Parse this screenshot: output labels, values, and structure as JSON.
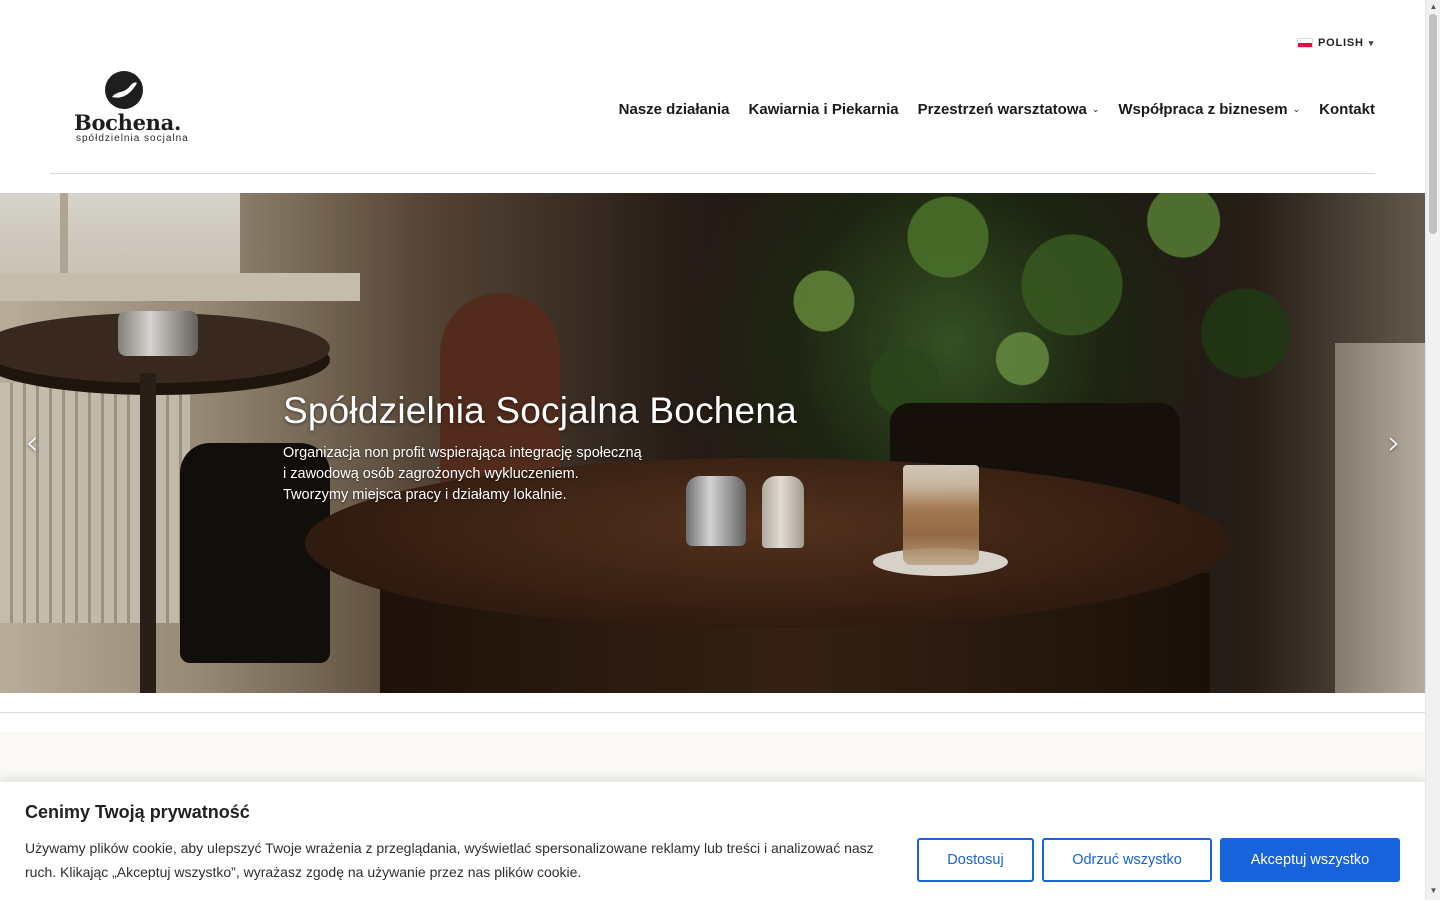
{
  "language": {
    "label": "POLISH",
    "caret": "▾"
  },
  "logo": {
    "name": "Bochena.",
    "tagline": "spółdzielnia socjalna"
  },
  "nav": {
    "items": [
      {
        "label": "Nasze działania",
        "dropdown": false
      },
      {
        "label": "Kawiarnia i Piekarnia",
        "dropdown": false
      },
      {
        "label": "Przestrzeń warsztatowa",
        "dropdown": true
      },
      {
        "label": "Współpraca z biznesem",
        "dropdown": true
      },
      {
        "label": "Kontakt",
        "dropdown": false
      }
    ],
    "chevron": "⌄"
  },
  "hero": {
    "title": "Spółdzielnia Socjalna Bochena",
    "lines": [
      "Organizacja non profit wspierająca integrację społeczną",
      "i zawodową osób zagrożonych wykluczeniem.",
      "Tworzymy miejsca pracy i działamy lokalnie."
    ],
    "prev_arrow": "‹",
    "next_arrow": "›"
  },
  "cookie": {
    "title": "Cenimy Twoją prywatność",
    "text": "Używamy plików cookie, aby ulepszyć Twoje wrażenia z przeglądania, wyświetlać spersonalizowane reklamy lub treści i analizować nasz ruch. Klikając „Akceptuj wszystko”, wyrażasz zgodę na używanie przez nas plików cookie.",
    "customize_label": "Dostosuj",
    "reject_label": "Odrzuć wszystko",
    "accept_label": "Akceptuj wszystko",
    "accent_color": "#1863dc"
  }
}
